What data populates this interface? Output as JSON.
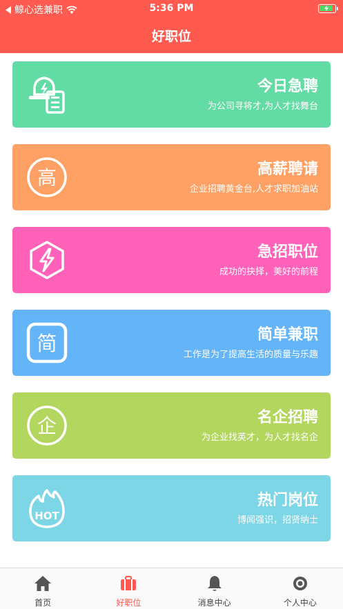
{
  "status_bar": {
    "back_app": "鲸心选兼职",
    "time": "5:36 PM"
  },
  "header": {
    "title": "好职位"
  },
  "cards": [
    {
      "title": "今日急聘",
      "subtitle": "为公司寻将才,为人才找舞台",
      "color": "#63dba4",
      "icon": "urgent-hire-icon"
    },
    {
      "title": "高薪聘请",
      "subtitle": "企业招聘黄金台,人才求职加油站",
      "color": "#ffa064",
      "icon": "high-salary-icon",
      "icon_text": "高"
    },
    {
      "title": "急招职位",
      "subtitle": "成功的抉择，美好的前程",
      "color": "#ff62b8",
      "icon": "lightning-hexagon-icon"
    },
    {
      "title": "简单兼职",
      "subtitle": "工作是为了提高生活的质量与乐趣",
      "color": "#64b4fa",
      "icon": "simple-parttime-icon",
      "icon_text": "简"
    },
    {
      "title": "名企招聘",
      "subtitle": "为企业找英才，为人才找名企",
      "color": "#b2d65e",
      "icon": "famous-company-icon",
      "icon_text": "企"
    },
    {
      "title": "热门岗位",
      "subtitle": "博闻强识，招贤纳士",
      "color": "#7dd6e6",
      "icon": "hot-flame-icon",
      "icon_text": "HOT"
    }
  ],
  "tabbar": {
    "items": [
      {
        "label": "首页",
        "icon": "home-icon",
        "active": false
      },
      {
        "label": "好职位",
        "icon": "briefcase-icon",
        "active": true
      },
      {
        "label": "消息中心",
        "icon": "bell-icon",
        "active": false
      },
      {
        "label": "个人中心",
        "icon": "user-circle-icon",
        "active": false
      }
    ],
    "active_color": "#ff5a4f",
    "inactive_color": "#555555"
  }
}
